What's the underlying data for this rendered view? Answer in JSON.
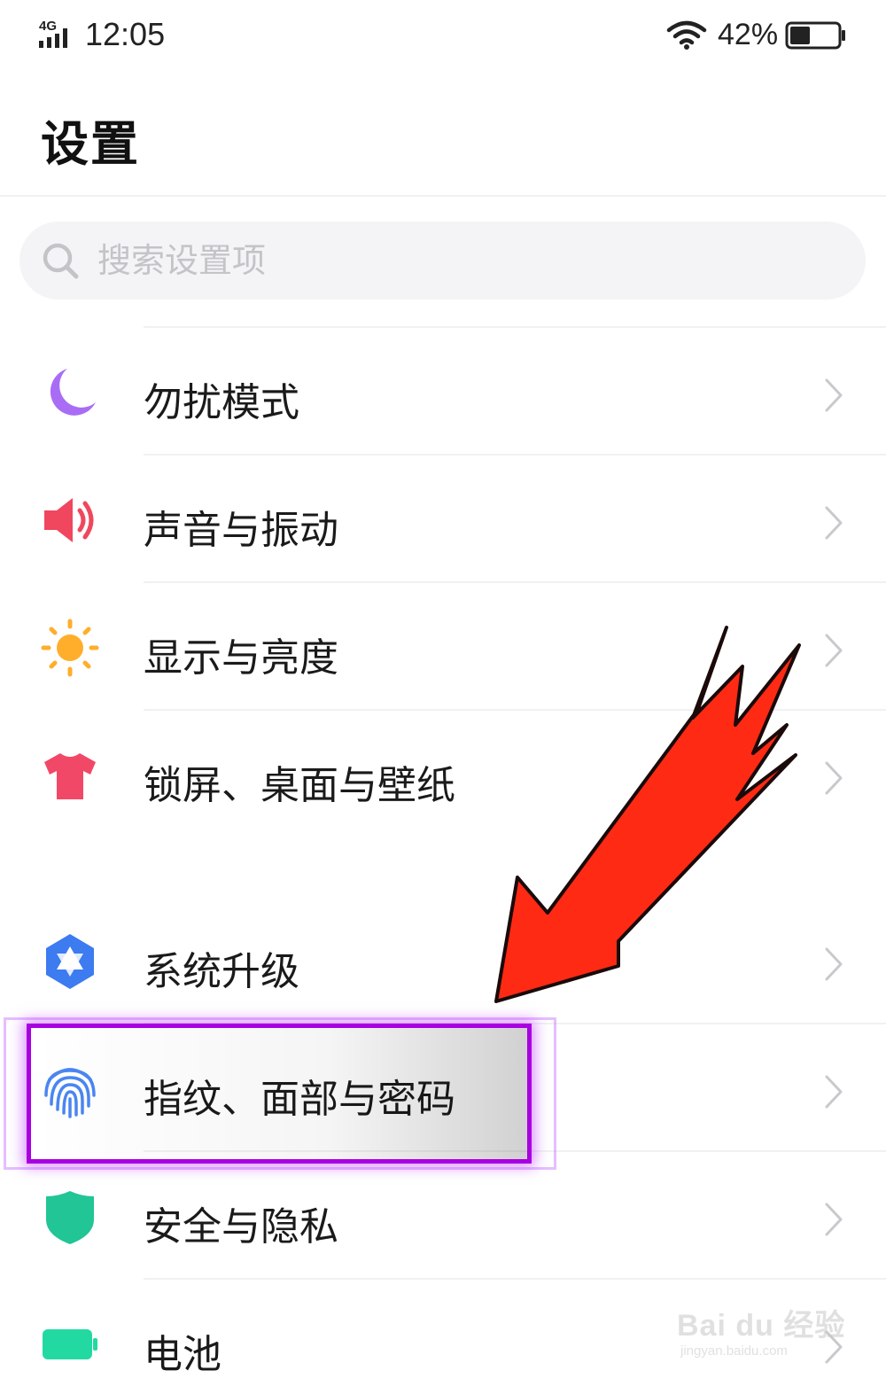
{
  "status_bar": {
    "network": "4G",
    "time": "12:05",
    "battery_percent": "42%",
    "battery_level": 0.42,
    "icons": [
      "signal-icon",
      "wifi-icon",
      "battery-icon"
    ]
  },
  "header": {
    "title": "设置"
  },
  "search": {
    "placeholder": "搜索设置项",
    "icon": "search-icon"
  },
  "settings_items": [
    {
      "label": "勿扰模式",
      "icon": "moon-icon",
      "color": "#a96df5"
    },
    {
      "label": "声音与振动",
      "icon": "speaker-icon",
      "color": "#f0475e"
    },
    {
      "label": "显示与亮度",
      "icon": "sun-icon",
      "color": "#ffae2b"
    },
    {
      "label": "锁屏、桌面与壁纸",
      "icon": "tshirt-icon",
      "color": "#f24868"
    },
    {
      "label": "系统升级",
      "icon": "system-upgrade-icon",
      "color": "#3c7bf0"
    },
    {
      "label": "指纹、面部与密码",
      "icon": "fingerprint-icon",
      "color": "#4a86f2",
      "highlighted": true
    },
    {
      "label": "安全与隐私",
      "icon": "shield-icon",
      "color": "#21c596"
    },
    {
      "label": "电池",
      "icon": "battery-green-icon",
      "color": "#23d9a2"
    }
  ],
  "annotation": {
    "arrow_color": "#ff2a14",
    "highlight_color": "#a800e0"
  },
  "watermark": {
    "logo": "Bai du 经验",
    "url": "jingyan.baidu.com"
  }
}
